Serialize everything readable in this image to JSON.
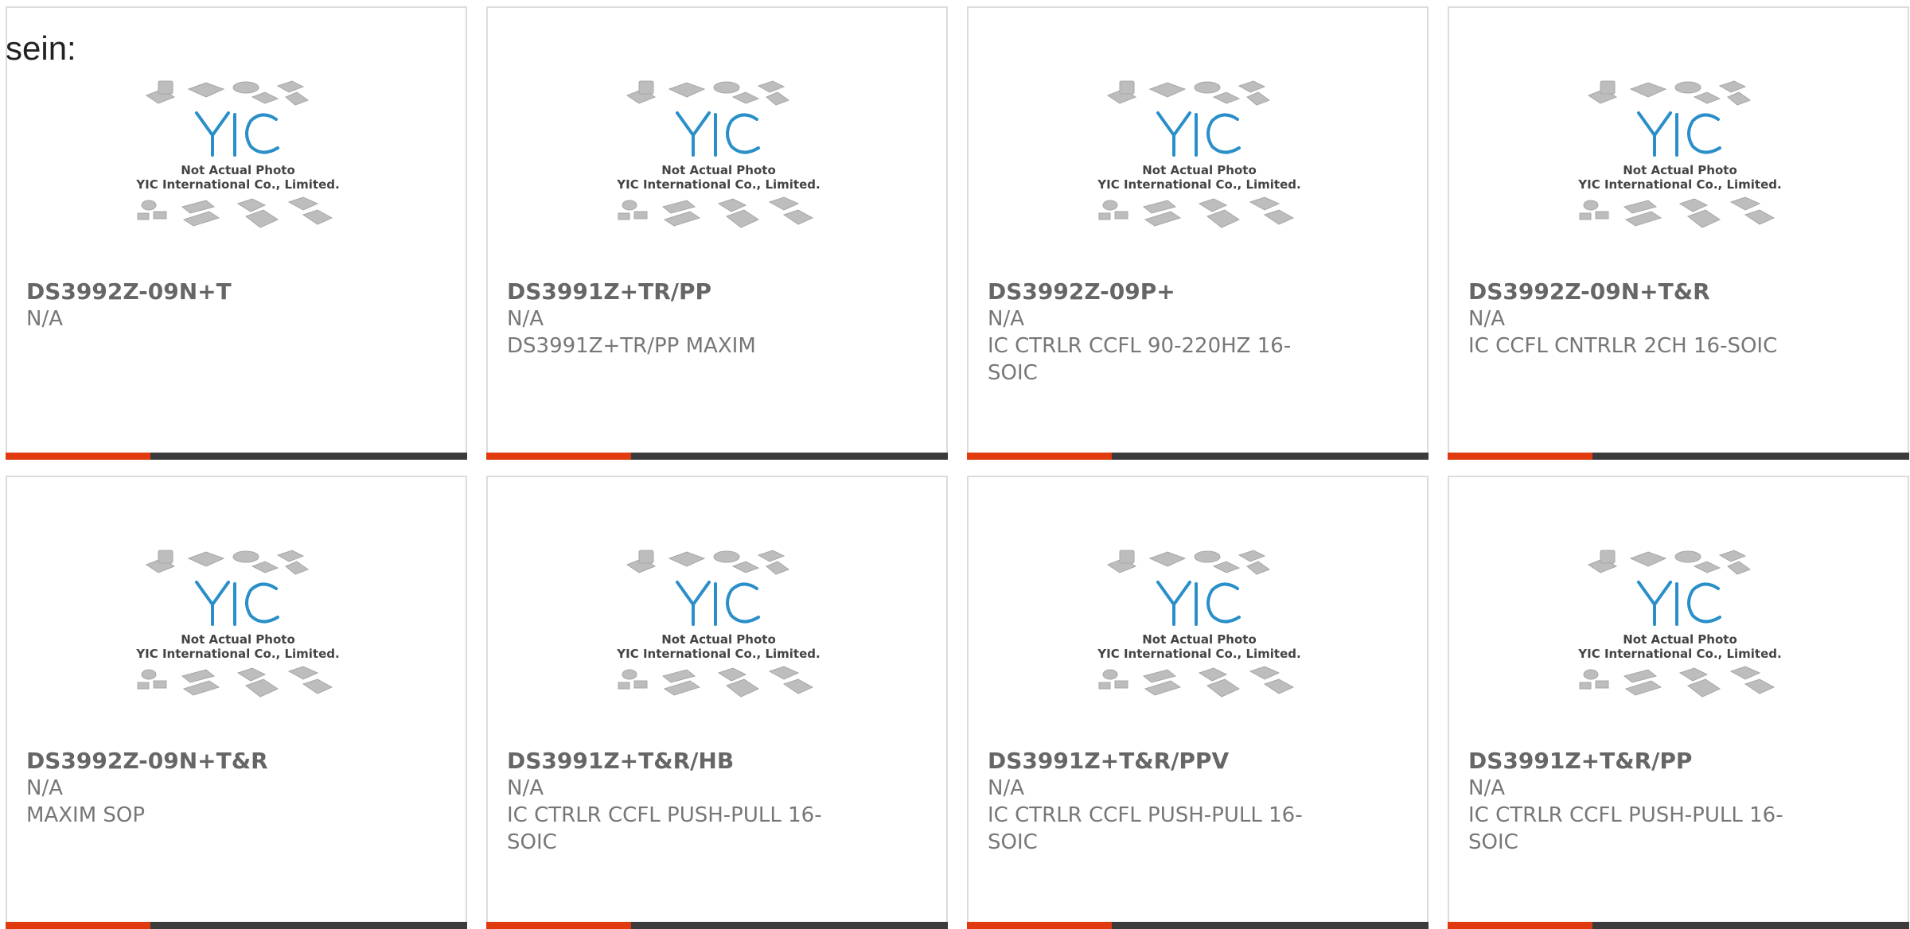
{
  "lead_text": "sein:",
  "photo": {
    "note_line1": "Not Actual Photo",
    "note_line2": "YIC International Co., Limited.",
    "logo_text": "YIC"
  },
  "accent_colors": {
    "bar_accent": "#e03a0e",
    "bar_base": "#3b3b3b",
    "logo": "#2a8fc8"
  },
  "products": [
    {
      "part": "DS3992Z-09N+T",
      "mfr": "N/A",
      "desc": ""
    },
    {
      "part": "DS3991Z+TR/PP",
      "mfr": "N/A",
      "desc": "DS3991Z+TR/PP MAXIM"
    },
    {
      "part": "DS3992Z-09P+",
      "mfr": "N/A",
      "desc": "IC CTRLR CCFL 90-220HZ 16-SOIC"
    },
    {
      "part": "DS3992Z-09N+T&R",
      "mfr": "N/A",
      "desc": "IC CCFL CNTRLR 2CH 16-SOIC"
    },
    {
      "part": "DS3992Z-09N+T&R",
      "mfr": "N/A",
      "desc": "MAXIM SOP"
    },
    {
      "part": "DS3991Z+T&R/HB",
      "mfr": "N/A",
      "desc": "IC CTRLR CCFL PUSH-PULL 16-SOIC"
    },
    {
      "part": "DS3991Z+T&R/PPV",
      "mfr": "N/A",
      "desc": "IC CTRLR CCFL PUSH-PULL 16-SOIC"
    },
    {
      "part": "DS3991Z+T&R/PP",
      "mfr": "N/A",
      "desc": "IC CTRLR CCFL PUSH-PULL 16-SOIC"
    }
  ]
}
